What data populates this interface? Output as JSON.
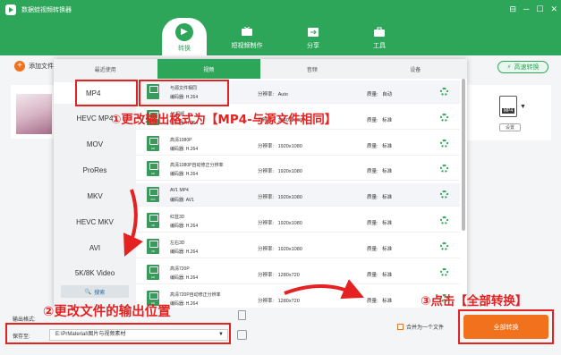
{
  "app": {
    "title": "数据蛙视频转换器",
    "window_controls": [
      "⊟",
      "─",
      "☐",
      "✕"
    ]
  },
  "nav": {
    "tabs": [
      {
        "label": "转换",
        "icon": "convert-icon"
      },
      {
        "label": "短视频制作",
        "icon": "tv-icon"
      },
      {
        "label": "分享",
        "icon": "share-icon"
      },
      {
        "label": "工具",
        "icon": "toolbox-icon"
      }
    ]
  },
  "toolbar": {
    "add_file": "添加文件",
    "fast_convert": "高速转换"
  },
  "file": {
    "output_format": "MP4",
    "settings_label": "设置"
  },
  "panel": {
    "tabs": [
      "最近使用",
      "视频",
      "音频",
      "设备"
    ],
    "active_tab": "视频",
    "formats": [
      "MP4",
      "HEVC MP4",
      "MOV",
      "ProRes",
      "MKV",
      "HEVC MKV",
      "AVI",
      "5K/8K Video"
    ],
    "selected_format": "MP4",
    "search_label": "搜索",
    "encoder_label": "编码器:",
    "resolution_label": "分辨率:",
    "quality_label": "质量:",
    "presets": [
      {
        "badge": "",
        "name": "与源文件相同",
        "encoder": "H.264",
        "resolution": "Auto",
        "quality": "自动"
      },
      {
        "badge": "4K",
        "name": "4K视频",
        "encoder": "H.264",
        "resolution": "3840x2160",
        "quality": "标准"
      },
      {
        "badge": "HD",
        "name": "高清1080P",
        "encoder": "H.264",
        "resolution": "1920x1080",
        "quality": "标准"
      },
      {
        "badge": "HD",
        "name": "高清1080P自动修正分辨率",
        "encoder": "H.264",
        "resolution": "1920x1080",
        "quality": "标准"
      },
      {
        "badge": "AV1",
        "name": "AV1 MP4",
        "encoder": "AV1",
        "resolution": "1920x1080",
        "quality": "标准"
      },
      {
        "badge": "3D",
        "name": "红蓝3D",
        "encoder": "H.264",
        "resolution": "1920x1080",
        "quality": "标准"
      },
      {
        "badge": "3D",
        "name": "左右3D",
        "encoder": "H.264",
        "resolution": "1920x1080",
        "quality": "标准"
      },
      {
        "badge": "HD",
        "name": "高清720P",
        "encoder": "H.264",
        "resolution": "1280x720",
        "quality": "标准"
      },
      {
        "badge": "HD",
        "name": "高清720P自动修正分辨率",
        "encoder": "H.264",
        "resolution": "1280x720",
        "quality": "标准"
      }
    ]
  },
  "bottom": {
    "output_format_label": "输出格式:",
    "save_to_label": "保存至:",
    "save_path": "E:\\PrMaterial\\图片与视频素材",
    "merge_label": "合并为一个文件",
    "convert_all": "全部转换"
  },
  "annotations": {
    "a1": "①更改输出格式为【MP4-与源文件相同】",
    "a2": "②更改文件的输出位置",
    "a3": "③点击【全部转换】"
  },
  "colors": {
    "brand": "#2ea65a",
    "accent": "#f2711c",
    "annotation": "#e52222"
  }
}
